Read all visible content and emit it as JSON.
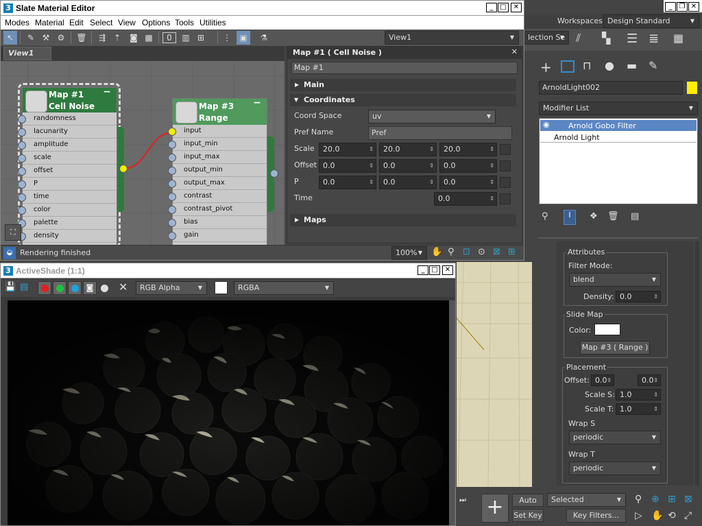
{
  "slate": {
    "title": "Slate Material Editor",
    "menu": [
      "Modes",
      "Material",
      "Edit",
      "Select",
      "View",
      "Options",
      "Tools",
      "Utilities"
    ],
    "view_dropdown": "View1",
    "view_tab": "View1",
    "status": "Rendering finished",
    "zoom": "100%",
    "nodes": {
      "cell": {
        "title1": "Map #1",
        "title2": "Cell Noise",
        "slots": [
          "randomness",
          "lacunarity",
          "amplitude",
          "scale",
          "offset",
          "P",
          "time",
          "color",
          "palette",
          "density"
        ]
      },
      "range": {
        "title1": "Map #3",
        "title2": "Range",
        "slots": [
          "input",
          "input_min",
          "input_max",
          "output_min",
          "output_max",
          "contrast",
          "contrast_pivot",
          "bias",
          "gain"
        ]
      }
    },
    "params": {
      "header": "Map #1  ( Cell Noise )",
      "name": "Map #1",
      "main": "Main",
      "coordinates": "Coordinates",
      "coord_space_label": "Coord Space",
      "coord_space": "uv",
      "pref_label": "Pref Name",
      "pref": "Pref",
      "scale_label": "Scale",
      "scale": [
        "20.0",
        "20.0",
        "20.0"
      ],
      "offset_label": "Offset",
      "offset": [
        "0.0",
        "0.0",
        "0.0"
      ],
      "p_label": "P",
      "p": [
        "0.0",
        "0.0",
        "0.0"
      ],
      "time_label": "Time",
      "time": "0.0",
      "maps": "Maps"
    }
  },
  "activeshade": {
    "title": "ActiveShade (1:1)",
    "channel": "RGB Alpha",
    "format": "RGBA"
  },
  "right": {
    "workspaces_label": "Workspaces:",
    "workspace": "Design Standard",
    "selection_set": "lection Se",
    "object_name": "ArnoldLight002",
    "modifier_list": "Modifier List",
    "stack": [
      "Arnold Gobo Filter",
      "Arnold Light"
    ],
    "attributes": "Attributes",
    "filter_mode_label": "Filter Mode:",
    "filter_mode": "blend",
    "density_label": "Density:",
    "density": "0.0",
    "slide_map": "Slide Map",
    "color_label": "Color:",
    "map_button": "Map #3  ( Range )",
    "placement": "Placement",
    "offset_label": "Offset:",
    "offset": [
      "0.0",
      "0.0"
    ],
    "scale_s_label": "Scale S:",
    "scale_s": "1.0",
    "scale_t_label": "Scale T:",
    "scale_t": "1.0",
    "wrap_s_label": "Wrap S",
    "wrap_s": "periodic",
    "wrap_t_label": "Wrap T",
    "wrap_t": "periodic",
    "auto_key": "Auto Key",
    "set_key": "Set Key",
    "selected": "Selected",
    "key_filters": "Key Filters..."
  },
  "colors": {
    "accent": "#5b86c4",
    "node_header": "#2f7a3e",
    "yellow_swatch": "#ffee00"
  }
}
